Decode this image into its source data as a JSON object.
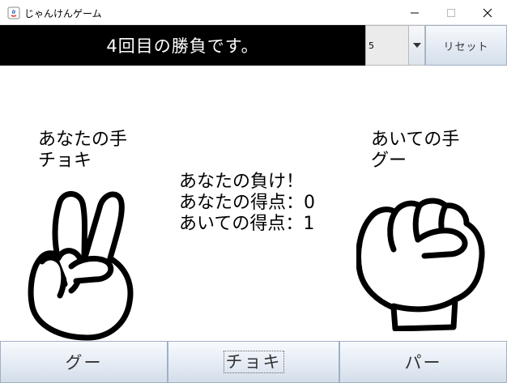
{
  "window": {
    "title": "じゃんけんゲーム"
  },
  "toolbar": {
    "round_message": "4回目の勝負です。",
    "round_select_value": "5",
    "reset_label": "リセット"
  },
  "player": {
    "heading": "あなたの手",
    "hand": "チョキ",
    "hand_icon": "scissors-hand-icon"
  },
  "opponent": {
    "heading": "あいての手",
    "hand": "グー",
    "hand_icon": "fist-hand-icon"
  },
  "result": {
    "outcome": "あなたの負け！",
    "player_score": "あなたの得点：0",
    "opponent_score": "あいての得点：1"
  },
  "choices": [
    {
      "label": "グー"
    },
    {
      "label": "チョキ"
    },
    {
      "label": "パー"
    }
  ],
  "colors": {
    "banner_bg": "#000000",
    "banner_text": "#ffffff",
    "button_border": "#9fb0c5"
  }
}
